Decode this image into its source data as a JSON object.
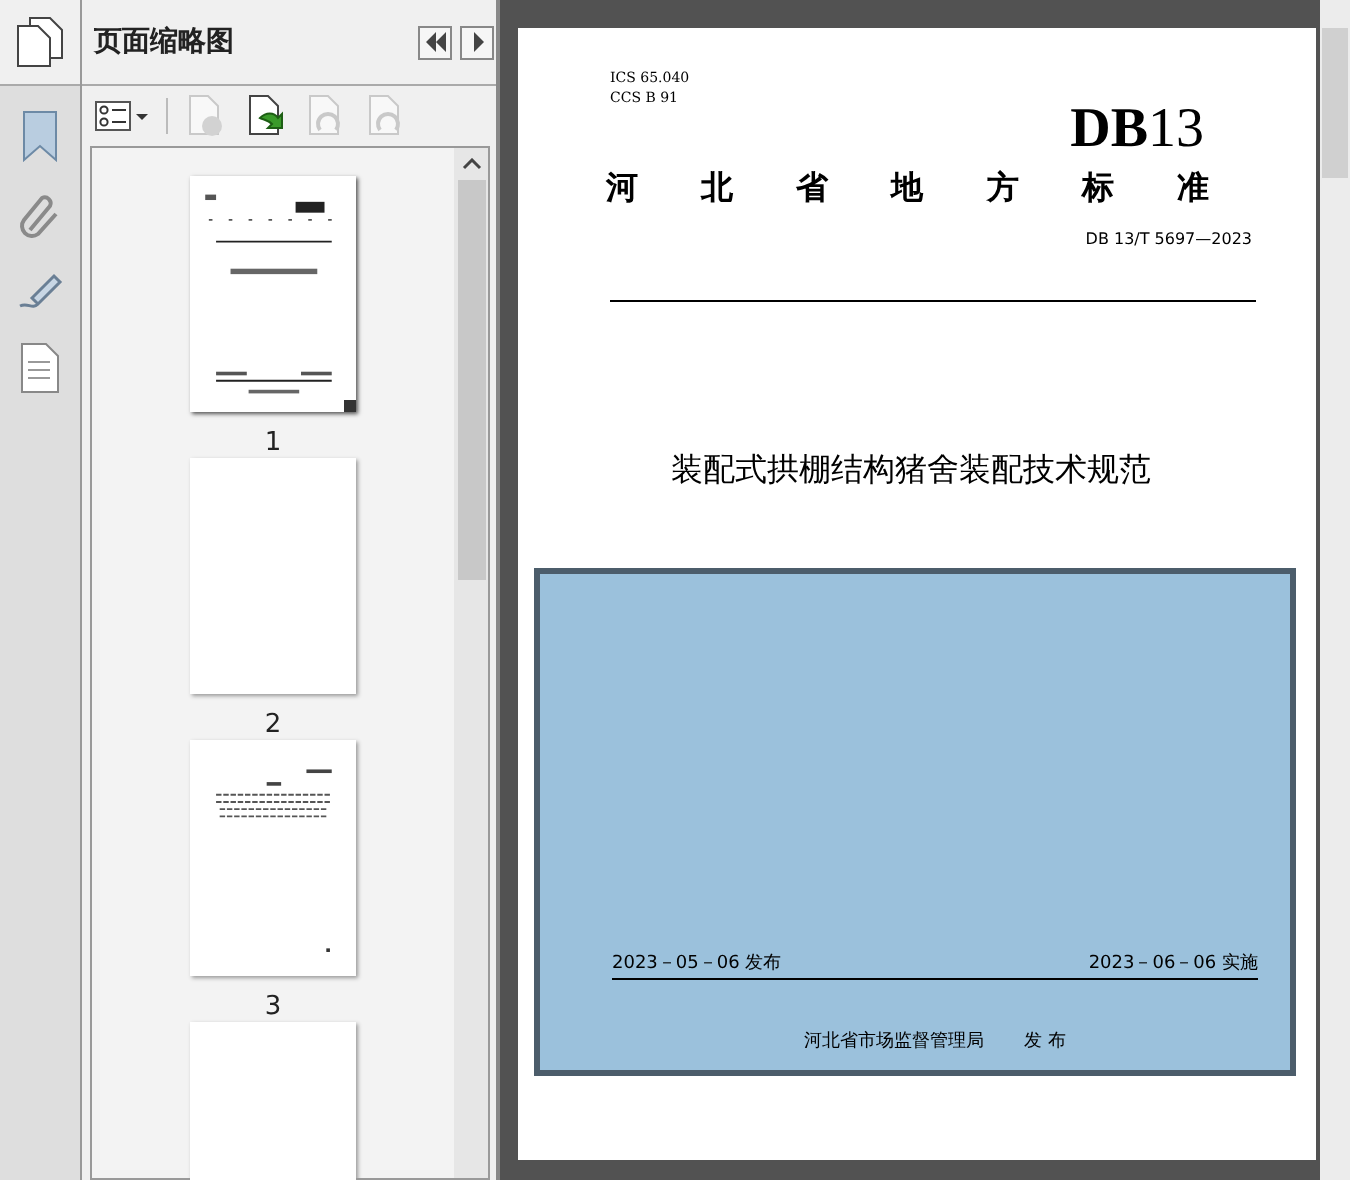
{
  "panel": {
    "title": "页面缩略图"
  },
  "rail": [
    {
      "kind": "bookmark",
      "selected": false
    },
    {
      "kind": "clip",
      "selected": false
    },
    {
      "kind": "sign",
      "selected": false
    },
    {
      "kind": "doc",
      "selected": false
    }
  ],
  "toolbar": [
    {
      "kind": "options",
      "disabled": false
    },
    {
      "kind": "delete",
      "disabled": true
    },
    {
      "kind": "insert",
      "disabled": false
    },
    {
      "kind": "undo",
      "disabled": true
    },
    {
      "kind": "redo",
      "disabled": true
    }
  ],
  "thumbnails": [
    {
      "label": "1",
      "kind": "cover",
      "selected": true
    },
    {
      "label": "2",
      "kind": "blank",
      "selected": false
    },
    {
      "label": "3",
      "kind": "text",
      "selected": false
    },
    {
      "kind": "blank",
      "selected": false
    }
  ],
  "document": {
    "ics": "ICS  65.040",
    "ccs": "CCS  B 91",
    "logo": "**DB**13",
    "heading": "河 北 省 地 方 标 准",
    "code": "DB 13/T  5697—2023",
    "title": "装配式拱棚结构猪舍装配技术规范",
    "highlighted": true,
    "release": "2023－05－06 发布",
    "effective": "2023－06－06 实施",
    "issuer": "河北省市场监督管理局",
    "issue_word": "发  布"
  }
}
